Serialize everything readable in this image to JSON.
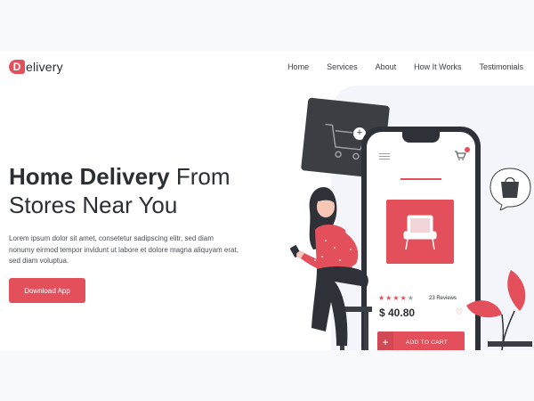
{
  "brand": {
    "badge": "D",
    "name": "elivery",
    "color": "#e3505c"
  },
  "nav": [
    {
      "label": "Home"
    },
    {
      "label": "Services"
    },
    {
      "label": "About"
    },
    {
      "label": "How It Works"
    },
    {
      "label": "Testimonials"
    }
  ],
  "hero": {
    "title_bold": "Home Delivery",
    "title_rest_line1": " From",
    "title_line2": "Stores Near You",
    "text": "Lorem ipsum dolor sit amet, consetetur sadipscing elitr, sed diam nonumy eirmod tempor invidunt ut labore et dolore magna aliquyam erat, sed diam voluptua.",
    "cta_label": "Download App"
  },
  "product_card": {
    "rating": 4,
    "max_rating": 5,
    "reviews": "23 Reviews",
    "price": "$ 40.80",
    "add_to_cart": "ADD TO CART"
  },
  "icons": [
    "logo-badge",
    "menu-icon",
    "cart-icon",
    "heart-icon",
    "plus-icon",
    "chair-icon",
    "shopping-bag-icon",
    "shopping-cart-icon"
  ]
}
